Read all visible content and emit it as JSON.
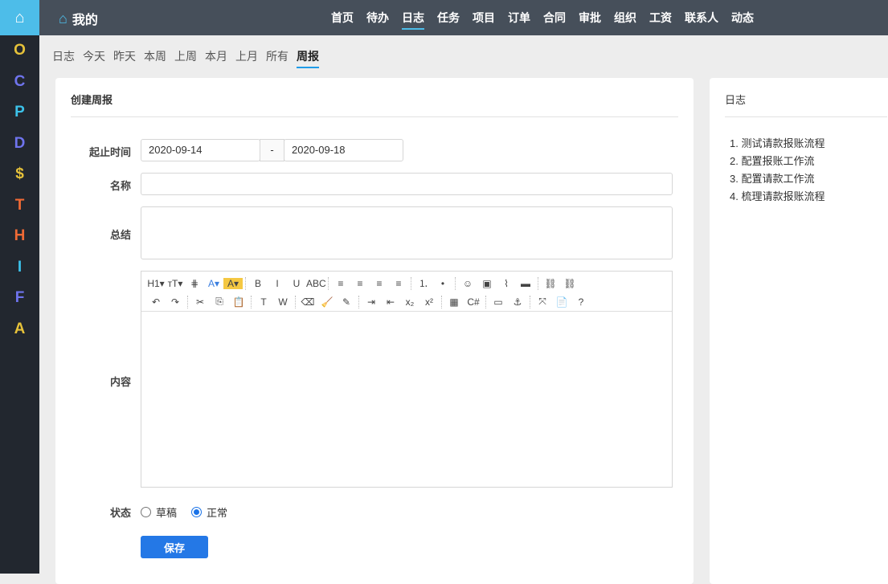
{
  "sidebar": {
    "letters": [
      {
        "t": "O",
        "c": "#e6c23a"
      },
      {
        "t": "C",
        "c": "#6f74ee"
      },
      {
        "t": "P",
        "c": "#3cc2ea"
      },
      {
        "t": "D",
        "c": "#6f74ee"
      },
      {
        "t": "$",
        "c": "#e6c23a"
      },
      {
        "t": "T",
        "c": "#f06a35"
      },
      {
        "t": "H",
        "c": "#f06a35"
      },
      {
        "t": "I",
        "c": "#3cc2ea"
      },
      {
        "t": "F",
        "c": "#6f74ee"
      },
      {
        "t": "A",
        "c": "#e6c23a"
      }
    ]
  },
  "header": {
    "title": "我的",
    "nav": [
      "首页",
      "待办",
      "日志",
      "任务",
      "项目",
      "订单",
      "合同",
      "审批",
      "组织",
      "工资",
      "联系人",
      "动态"
    ],
    "active": 2
  },
  "tabs": {
    "items": [
      "日志",
      "今天",
      "昨天",
      "本周",
      "上周",
      "本月",
      "上月",
      "所有",
      "周报"
    ],
    "active": 8
  },
  "form": {
    "title": "创建周报",
    "range_label": "起止时间",
    "start": "2020-09-14",
    "sep": "-",
    "end": "2020-09-18",
    "name_label": "名称",
    "name_value": "",
    "summary_label": "总结",
    "content_label": "内容",
    "status_label": "状态",
    "status_options": [
      "草稿",
      "正常"
    ],
    "status_selected": "正常",
    "save": "保存"
  },
  "toolbar": {
    "row1": [
      "H1▾",
      "тT▾",
      "⋕",
      "A▾",
      "A▾",
      "|",
      "B",
      "I",
      "U",
      "ABC",
      "|",
      "≡",
      "≡",
      "≡",
      "≡",
      "|",
      "⒈",
      "•",
      "|",
      "☺",
      "▣",
      "⌇",
      "▬",
      "|",
      "⛓",
      "⛓"
    ],
    "row2": [
      "↶",
      "↷",
      "|",
      "✂",
      "⎘",
      "📋",
      "|",
      "T",
      "W",
      "|",
      "⌫",
      "🧹",
      "✎",
      "|",
      "⇥",
      "⇤",
      "x₂",
      "x²",
      "|",
      "▦",
      "C#",
      "|",
      "▭",
      "⚓",
      "|",
      "⤧",
      "📄",
      "?"
    ]
  },
  "log": {
    "title": "日志",
    "items": [
      "1. 测试请款报账流程",
      "2. 配置报账工作流",
      "3. 配置请款工作流",
      "4. 梳理请款报账流程"
    ]
  }
}
